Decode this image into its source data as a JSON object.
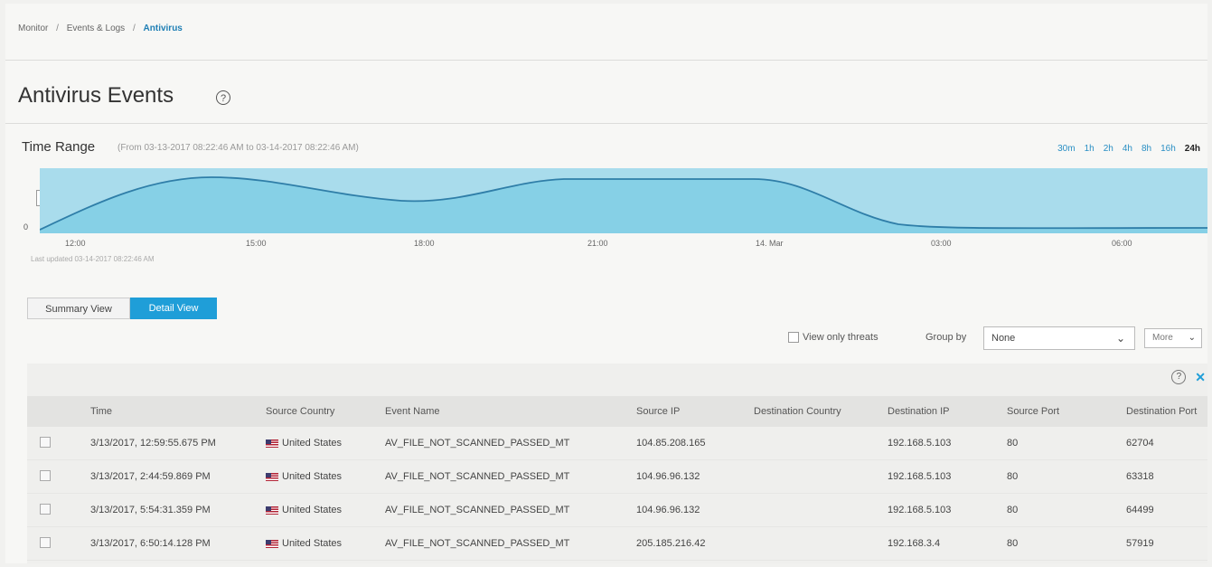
{
  "breadcrumb": {
    "item1": "Monitor",
    "item2": "Events & Logs",
    "current": "Antivirus",
    "sep": "/"
  },
  "page": {
    "title": "Antivirus Events"
  },
  "time_range": {
    "label": "Time Range",
    "subtitle": "(From 03-13-2017 08:22:46 AM to 03-14-2017 08:22:46 AM)",
    "buttons": [
      "30m",
      "1h",
      "2h",
      "4h",
      "8h",
      "16h",
      "24h"
    ],
    "selected": "24h",
    "last_updated": "Last updated 03-14-2017 08:22:46 AM"
  },
  "chart_data": {
    "type": "area",
    "x": [
      "12:00",
      "15:00",
      "18:00",
      "21:00",
      "14. Mar",
      "03:00",
      "06:00"
    ],
    "y_tick": "0",
    "color": "#5bc2e0",
    "fill": "#a9dcec"
  },
  "views": {
    "summary": "Summary View",
    "detail": "Detail View",
    "active": "detail"
  },
  "filters": {
    "threats_label": "View only threats",
    "threats_checked": false,
    "groupby_label": "Group by",
    "groupby_value": "None",
    "more_label": "More"
  },
  "table": {
    "columns": [
      "Time",
      "Source Country",
      "Event Name",
      "Source IP",
      "Destination Country",
      "Destination IP",
      "Source Port",
      "Destination Port"
    ],
    "rows": [
      {
        "time": "3/13/2017, 12:59:55.675 PM",
        "country": "United States",
        "event": "AV_FILE_NOT_SCANNED_PASSED_MT",
        "src_ip": "104.85.208.165",
        "dst_country": "",
        "dst_ip": "192.168.5.103",
        "src_port": "80",
        "dst_port": "62704"
      },
      {
        "time": "3/13/2017, 2:44:59.869 PM",
        "country": "United States",
        "event": "AV_FILE_NOT_SCANNED_PASSED_MT",
        "src_ip": "104.96.96.132",
        "dst_country": "",
        "dst_ip": "192.168.5.103",
        "src_port": "80",
        "dst_port": "63318"
      },
      {
        "time": "3/13/2017, 5:54:31.359 PM",
        "country": "United States",
        "event": "AV_FILE_NOT_SCANNED_PASSED_MT",
        "src_ip": "104.96.96.132",
        "dst_country": "",
        "dst_ip": "192.168.5.103",
        "src_port": "80",
        "dst_port": "64499"
      },
      {
        "time": "3/13/2017, 6:50:14.128 PM",
        "country": "United States",
        "event": "AV_FILE_NOT_SCANNED_PASSED_MT",
        "src_ip": "205.185.216.42",
        "dst_country": "",
        "dst_ip": "192.168.3.4",
        "src_port": "80",
        "dst_port": "57919"
      }
    ]
  }
}
